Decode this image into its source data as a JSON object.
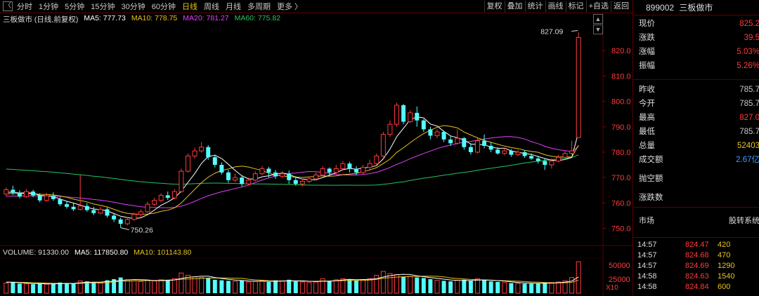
{
  "toolbar": {
    "back": "〈",
    "periods": [
      "分时",
      "1分钟",
      "5分钟",
      "15分钟",
      "30分钟",
      "60分钟",
      "日线",
      "周线",
      "月线",
      "多周期",
      "更多 〉"
    ],
    "active_period": "日线",
    "right_buttons": [
      "复权",
      "叠加",
      "统计",
      "画线",
      "标记",
      "+自选",
      "返回"
    ]
  },
  "legend": {
    "title": "三板做市 (日线,前复权)",
    "ma5": "MA5: 777.73",
    "ma10": "MA10: 778.75",
    "ma20": "MA20: 781.27",
    "ma60": "MA60: 775.82"
  },
  "volume_legend": {
    "title": "VOLUME: 91330.00",
    "ma5": "MA5: 117850.80",
    "ma10": "MA10: 101143.80"
  },
  "annotations": {
    "high": "827.09",
    "low": "750.26"
  },
  "price_axis": [
    "820.0",
    "810.0",
    "800.0",
    "790.0",
    "780.0",
    "770.0",
    "760.0",
    "750.0"
  ],
  "volume_axis": [
    "50000",
    "25000"
  ],
  "volume_unit": "X10",
  "colors": {
    "up": "#ff3b3b",
    "down": "#54ffff",
    "ma5": "#ffffff",
    "ma10": "#e8c31a",
    "ma20": "#e040fb",
    "ma60": "#22c55e",
    "grid": "#3a0000"
  },
  "chart_data": {
    "type": "candlestick",
    "y_range": [
      746,
      830
    ],
    "volume_range": [
      0,
      60000
    ],
    "candles": [
      [
        763.5,
        765.2,
        762.5,
        766.1,
        1800
      ],
      [
        765.2,
        764.0,
        763.2,
        766.8,
        1900
      ],
      [
        764.0,
        762.5,
        761.8,
        765.0,
        1700
      ],
      [
        762.5,
        764.5,
        762.0,
        765.5,
        1650
      ],
      [
        764.5,
        763.0,
        762.2,
        765.2,
        1600
      ],
      [
        763.0,
        761.0,
        760.2,
        763.8,
        1750
      ],
      [
        761.0,
        762.8,
        760.5,
        764.0,
        1600
      ],
      [
        762.8,
        761.5,
        760.8,
        764.2,
        1650
      ],
      [
        761.5,
        759.5,
        758.8,
        762.2,
        1900
      ],
      [
        759.5,
        758.5,
        757.8,
        760.8,
        1800
      ],
      [
        758.5,
        757.5,
        756.8,
        759.8,
        1750
      ],
      [
        757.5,
        758.8,
        757.0,
        771.0,
        2200
      ],
      [
        758.8,
        757.2,
        756.5,
        760.0,
        2100
      ],
      [
        757.2,
        756.0,
        755.2,
        758.5,
        2000
      ],
      [
        756.0,
        757.5,
        755.5,
        758.5,
        1800
      ],
      [
        757.5,
        755.0,
        754.2,
        758.2,
        2300
      ],
      [
        755.0,
        753.5,
        752.5,
        756.0,
        2500
      ],
      [
        753.5,
        751.8,
        750.26,
        754.2,
        2800
      ],
      [
        751.8,
        753.5,
        751.2,
        754.5,
        2400
      ],
      [
        753.5,
        755.5,
        753.0,
        756.2,
        2200
      ],
      [
        755.5,
        756.5,
        754.5,
        757.5,
        2100
      ],
      [
        756.5,
        759.5,
        756.0,
        760.5,
        2300
      ],
      [
        759.5,
        761.0,
        758.8,
        762.0,
        2200
      ],
      [
        761.0,
        763.0,
        760.2,
        763.8,
        2400
      ],
      [
        763.0,
        762.0,
        761.2,
        764.5,
        2300
      ],
      [
        762.0,
        764.5,
        761.5,
        765.5,
        2600
      ],
      [
        764.5,
        772.5,
        764.0,
        773.5,
        3600
      ],
      [
        772.5,
        778.5,
        772.0,
        779.5,
        3200
      ],
      [
        778.5,
        780.5,
        777.5,
        781.8,
        2900
      ],
      [
        780.5,
        782.0,
        779.8,
        784.0,
        2800
      ],
      [
        782.0,
        778.0,
        777.0,
        782.8,
        2700
      ],
      [
        778.0,
        775.0,
        774.0,
        779.0,
        2400
      ],
      [
        775.0,
        772.0,
        771.2,
        776.0,
        2300
      ],
      [
        772.0,
        769.0,
        768.0,
        773.0,
        2200
      ],
      [
        769.0,
        770.0,
        768.2,
        771.5,
        2100
      ],
      [
        770.0,
        767.5,
        766.5,
        771.0,
        2300
      ],
      [
        767.5,
        769.0,
        766.8,
        770.0,
        2000
      ],
      [
        769.0,
        771.5,
        768.5,
        772.5,
        2100
      ],
      [
        771.5,
        773.5,
        771.0,
        774.5,
        2200
      ],
      [
        773.5,
        772.0,
        770.0,
        774.2,
        2000
      ],
      [
        772.0,
        770.5,
        769.5,
        773.0,
        2300
      ],
      [
        770.5,
        771.5,
        769.8,
        772.5,
        2200
      ],
      [
        771.5,
        769.0,
        767.5,
        772.8,
        2400
      ],
      [
        769.0,
        767.5,
        766.8,
        770.5,
        2100
      ],
      [
        767.5,
        768.5,
        766.5,
        769.5,
        2000
      ],
      [
        768.5,
        769.5,
        767.8,
        770.5,
        1900
      ],
      [
        769.5,
        771.0,
        768.8,
        772.0,
        2000
      ],
      [
        771.0,
        773.5,
        770.5,
        774.5,
        2600
      ],
      [
        773.5,
        772.0,
        770.5,
        774.0,
        2200
      ],
      [
        772.0,
        773.5,
        771.0,
        775.0,
        2400
      ],
      [
        773.5,
        775.5,
        772.8,
        776.5,
        2600
      ],
      [
        775.5,
        773.5,
        772.0,
        776.2,
        2500
      ],
      [
        773.5,
        772.0,
        771.0,
        774.5,
        2300
      ],
      [
        772.0,
        774.0,
        771.2,
        775.0,
        2400
      ],
      [
        774.0,
        775.5,
        773.0,
        777.0,
        2600
      ],
      [
        775.5,
        778.5,
        775.0,
        779.5,
        3200
      ],
      [
        778.5,
        787.0,
        778.0,
        788.0,
        3900
      ],
      [
        787.0,
        791.0,
        786.0,
        792.5,
        3500
      ],
      [
        791.0,
        798.5,
        790.0,
        799.5,
        3300
      ],
      [
        798.5,
        792.0,
        791.0,
        799.0,
        2900
      ],
      [
        792.0,
        795.5,
        791.5,
        796.5,
        3000
      ],
      [
        795.5,
        792.5,
        790.0,
        798.0,
        2800
      ],
      [
        792.5,
        789.0,
        788.0,
        793.0,
        2700
      ],
      [
        789.0,
        786.5,
        785.0,
        790.0,
        2500
      ],
      [
        786.5,
        788.0,
        785.5,
        789.0,
        2300
      ],
      [
        788.0,
        785.0,
        784.0,
        788.5,
        2200
      ],
      [
        785.0,
        783.5,
        782.5,
        786.5,
        2100
      ],
      [
        783.5,
        785.5,
        783.0,
        789.0,
        2300
      ],
      [
        785.5,
        782.0,
        781.0,
        786.0,
        2400
      ],
      [
        782.0,
        780.0,
        779.0,
        783.5,
        2200
      ],
      [
        780.0,
        784.5,
        779.5,
        785.5,
        2600
      ],
      [
        784.5,
        782.5,
        781.5,
        787.0,
        2300
      ],
      [
        782.5,
        781.0,
        780.0,
        784.0,
        2100
      ],
      [
        781.0,
        779.5,
        779.0,
        782.0,
        2000
      ],
      [
        779.5,
        780.5,
        778.8,
        781.5,
        1900
      ],
      [
        780.5,
        779.0,
        778.2,
        781.2,
        1800
      ],
      [
        779.0,
        780.0,
        778.5,
        781.0,
        1750
      ],
      [
        780.0,
        778.5,
        777.8,
        780.8,
        1700
      ],
      [
        778.5,
        777.5,
        777.0,
        779.5,
        1700
      ],
      [
        777.5,
        776.5,
        775.5,
        778.5,
        1800
      ],
      [
        776.5,
        775.0,
        773.0,
        777.5,
        1900
      ],
      [
        775.0,
        776.5,
        773.5,
        777.5,
        1900
      ],
      [
        776.5,
        778.0,
        776.0,
        779.0,
        2000
      ],
      [
        778.0,
        779.5,
        777.5,
        780.5,
        2200
      ],
      [
        779.5,
        780.5,
        779.0,
        784.5,
        2800
      ],
      [
        785.78,
        825.2,
        785.78,
        827.09,
        5600
      ]
    ]
  },
  "info": {
    "code": "899002",
    "name": "三板做市",
    "rows": [
      {
        "label": "现价",
        "value": "825.2",
        "color": "red"
      },
      {
        "label": "涨跌",
        "value": "39.5",
        "color": "red"
      },
      {
        "label": "涨幅",
        "value": "5.03%",
        "color": "red"
      },
      {
        "label": "振幅",
        "value": "5.26%",
        "color": "red"
      },
      {
        "label": "昨收",
        "value": "785.7",
        "color": "plain"
      },
      {
        "label": "今开",
        "value": "785.7",
        "color": "plain"
      },
      {
        "label": "最高",
        "value": "827.0",
        "color": "red"
      },
      {
        "label": "最低",
        "value": "785.7",
        "color": "plain"
      },
      {
        "label": "总量",
        "value": "52403",
        "color": "yellow"
      },
      {
        "label": "成交额",
        "value": "2.67亿",
        "color": "blue"
      },
      {
        "label": "抛空额",
        "value": "",
        "color": "plain"
      },
      {
        "label": "涨跌数",
        "value": "",
        "color": "plain"
      }
    ],
    "table_header": {
      "col1": "市场",
      "col2": "股转系统"
    },
    "ticks": [
      {
        "time": "14:57",
        "price": "824.47",
        "vol": "420"
      },
      {
        "time": "14:57",
        "price": "824.68",
        "vol": "470"
      },
      {
        "time": "14:57",
        "price": "824.69",
        "vol": "1290"
      },
      {
        "time": "14:58",
        "price": "824.63",
        "vol": "1540"
      },
      {
        "time": "14:58",
        "price": "824.84",
        "vol": "600"
      }
    ]
  }
}
